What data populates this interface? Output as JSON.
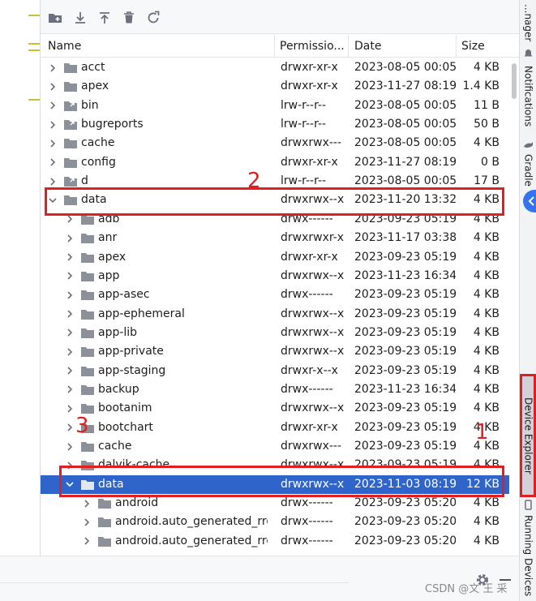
{
  "toolbar": {
    "buttons": [
      "new-folder-icon",
      "download-icon",
      "upload-icon",
      "delete-icon",
      "refresh-icon"
    ]
  },
  "table": {
    "columns": [
      "Name",
      "Permissio...",
      "Date",
      "Size"
    ]
  },
  "rows": [
    {
      "name": "acct",
      "perm": "drwxr-xr-x",
      "date": "2023-08-05 00:05",
      "size": "4 KB",
      "indent": 0,
      "expanded": false,
      "link": false
    },
    {
      "name": "apex",
      "perm": "drwxr-xr-x",
      "date": "2023-11-27 08:19",
      "size": "1.4 KB",
      "indent": 0,
      "expanded": false,
      "link": false
    },
    {
      "name": "bin",
      "perm": "lrw-r--r--",
      "date": "2023-08-05 00:05",
      "size": "11 B",
      "indent": 0,
      "expanded": false,
      "link": true
    },
    {
      "name": "bugreports",
      "perm": "lrw-r--r--",
      "date": "2023-08-05 00:05",
      "size": "50 B",
      "indent": 0,
      "expanded": false,
      "link": true
    },
    {
      "name": "cache",
      "perm": "drwxrwx---",
      "date": "2023-08-05 00:05",
      "size": "4 KB",
      "indent": 0,
      "expanded": false,
      "link": false
    },
    {
      "name": "config",
      "perm": "drwxr-xr-x",
      "date": "2023-11-27 08:19",
      "size": "0 B",
      "indent": 0,
      "expanded": false,
      "link": false
    },
    {
      "name": "d",
      "perm": "lrw-r--r--",
      "date": "2023-08-05 00:05",
      "size": "17 B",
      "indent": 0,
      "expanded": false,
      "link": true
    },
    {
      "name": "data",
      "perm": "drwxrwx--x",
      "date": "2023-11-20 13:32",
      "size": "4 KB",
      "indent": 0,
      "expanded": true,
      "link": false
    },
    {
      "name": "adb",
      "perm": "drwx------",
      "date": "2023-09-23 05:19",
      "size": "4 KB",
      "indent": 1,
      "expanded": false,
      "link": false
    },
    {
      "name": "anr",
      "perm": "drwxrwxr-x",
      "date": "2023-11-17 03:38",
      "size": "4 KB",
      "indent": 1,
      "expanded": false,
      "link": false
    },
    {
      "name": "apex",
      "perm": "drwxr-xr-x",
      "date": "2023-09-23 05:19",
      "size": "4 KB",
      "indent": 1,
      "expanded": false,
      "link": false
    },
    {
      "name": "app",
      "perm": "drwxrwx--x",
      "date": "2023-11-23 16:34",
      "size": "4 KB",
      "indent": 1,
      "expanded": false,
      "link": false
    },
    {
      "name": "app-asec",
      "perm": "drwx------",
      "date": "2023-09-23 05:19",
      "size": "4 KB",
      "indent": 1,
      "expanded": false,
      "link": false
    },
    {
      "name": "app-ephemeral",
      "perm": "drwxrwx--x",
      "date": "2023-09-23 05:19",
      "size": "4 KB",
      "indent": 1,
      "expanded": false,
      "link": false
    },
    {
      "name": "app-lib",
      "perm": "drwxrwx--x",
      "date": "2023-09-23 05:19",
      "size": "4 KB",
      "indent": 1,
      "expanded": false,
      "link": false
    },
    {
      "name": "app-private",
      "perm": "drwxrwx--x",
      "date": "2023-09-23 05:19",
      "size": "4 KB",
      "indent": 1,
      "expanded": false,
      "link": false
    },
    {
      "name": "app-staging",
      "perm": "drwxr-x--x",
      "date": "2023-09-23 05:19",
      "size": "4 KB",
      "indent": 1,
      "expanded": false,
      "link": false
    },
    {
      "name": "backup",
      "perm": "drwx------",
      "date": "2023-11-23 16:34",
      "size": "4 KB",
      "indent": 1,
      "expanded": false,
      "link": false
    },
    {
      "name": "bootanim",
      "perm": "drwxrwx--x",
      "date": "2023-09-23 05:19",
      "size": "4 KB",
      "indent": 1,
      "expanded": false,
      "link": false
    },
    {
      "name": "bootchart",
      "perm": "drwxr-xr-x",
      "date": "2023-09-23 05:19",
      "size": "4 KB",
      "indent": 1,
      "expanded": false,
      "link": false
    },
    {
      "name": "cache",
      "perm": "drwxrwx---",
      "date": "2023-09-23 05:19",
      "size": "4 KB",
      "indent": 1,
      "expanded": false,
      "link": false
    },
    {
      "name": "dalvik-cache",
      "perm": "drwxrwx--x",
      "date": "2023-09-23 05:19",
      "size": "4 KB",
      "indent": 1,
      "expanded": false,
      "link": false
    },
    {
      "name": "data",
      "perm": "drwxrwx--x",
      "date": "2023-11-03 08:19",
      "size": "12 KB",
      "indent": 1,
      "expanded": true,
      "link": false,
      "selected": true
    },
    {
      "name": "android",
      "perm": "drwx------",
      "date": "2023-09-23 05:20",
      "size": "4 KB",
      "indent": 2,
      "expanded": false,
      "link": false
    },
    {
      "name": "android.auto_generated_rro_",
      "perm": "drwx------",
      "date": "2023-09-23 05:20",
      "size": "4 KB",
      "indent": 2,
      "expanded": false,
      "link": false
    },
    {
      "name": "android.auto_generated_rro_",
      "perm": "drwx------",
      "date": "2023-09-23 05:20",
      "size": "4 KB",
      "indent": 2,
      "expanded": false,
      "link": false
    }
  ],
  "sidebar_tabs": [
    {
      "label": "...nager",
      "icon": ""
    },
    {
      "label": "Notifications",
      "icon": "bell-icon"
    },
    {
      "label": "Gradle",
      "icon": "gradle-icon"
    },
    {
      "label": "Device Explorer",
      "icon": "device-icon"
    },
    {
      "label": "Running Devices",
      "icon": "phone-icon"
    }
  ],
  "annotations": [
    "1",
    "2",
    "3"
  ],
  "watermark": "CSDN @文 王 采",
  "colors": {
    "selection": "#2f65ca",
    "annotation": "#e02020",
    "accent": "#3574f0"
  }
}
